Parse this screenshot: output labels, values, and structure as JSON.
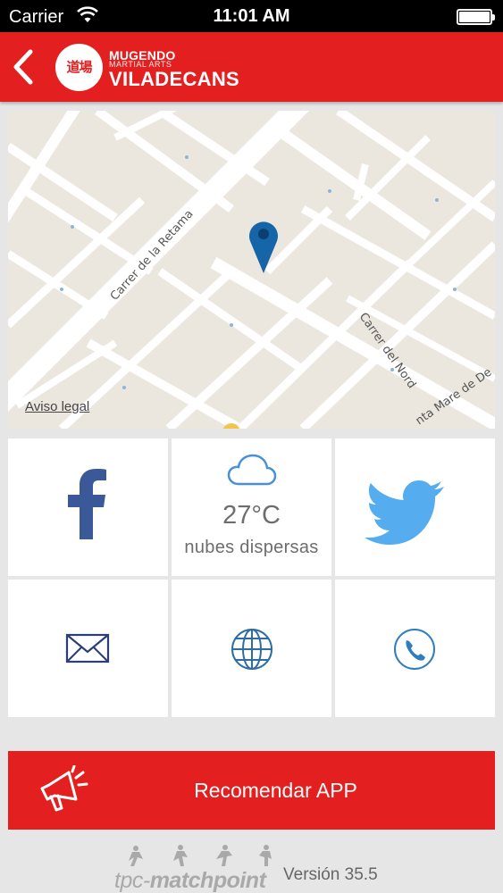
{
  "status_bar": {
    "carrier": "Carrier",
    "time": "11:01 AM"
  },
  "header": {
    "logo_glyph": "道場",
    "brand_name": "MUGENDO",
    "brand_sub": "MARTIAL ARTS",
    "brand_city": "VILADECANS",
    "accent_color": "#e3201f"
  },
  "map": {
    "street_labels": [
      "Carrer de la Retama",
      "Carrer del Nord",
      "nta Mare de De"
    ],
    "legal_link": "Aviso legal",
    "pin_color": "#1565a8"
  },
  "tiles": {
    "facebook": {
      "icon": "facebook-icon",
      "color": "#3b5998"
    },
    "weather": {
      "icon": "cloud-icon",
      "temperature": "27°C",
      "description": "nubes dispersas"
    },
    "twitter": {
      "icon": "twitter-icon",
      "color": "#55acee"
    },
    "email": {
      "icon": "envelope-icon"
    },
    "web": {
      "icon": "globe-icon"
    },
    "phone": {
      "icon": "phone-icon"
    }
  },
  "recommend": {
    "label": "Recomendar APP",
    "icon": "megaphone-icon"
  },
  "footer": {
    "logo_light": "tpc-",
    "logo_bold": "matchpoint",
    "version": "Versión 35.5"
  }
}
